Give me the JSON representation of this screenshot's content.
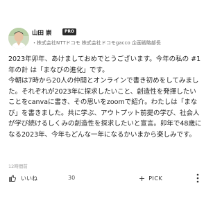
{
  "post": {
    "author": {
      "name": "山田 崇",
      "badge": "PRO",
      "title": "・株式会社NTTドコモ 株式会社ドコモgacco 企画戦略部長"
    },
    "text": "2023年卯年、あけましておめでとうございます。今年の私の #1年の計 は「まなびの進化」です。\n今朝は7時から20人の仲間とオンラインで書き初めをしてみました。それぞれが2023年に探求したいこと、創造性を発揮したいことをcanvaに書き、その思いをzoomで紹介。わたしは「まなび」を書きました。共に学ぶ、アウトプット前提の学び、社会人が学び続けるしくみの創造性を探求したいと宣言。卯年で48歳になる2023年、今年もどんな一年になるかいまから楽しみです。",
    "timestamp": "12時間前"
  },
  "actions": {
    "like_label": "いいね",
    "like_count": "30",
    "pick_plus": "+",
    "pick_label": "PICK",
    "icons": {
      "like": "thumbs-up-icon",
      "more": "more-vertical-icon"
    }
  },
  "colors": {
    "badge_bg": "#2a2a2a",
    "text": "#222222",
    "muted": "#a0a0a0"
  }
}
